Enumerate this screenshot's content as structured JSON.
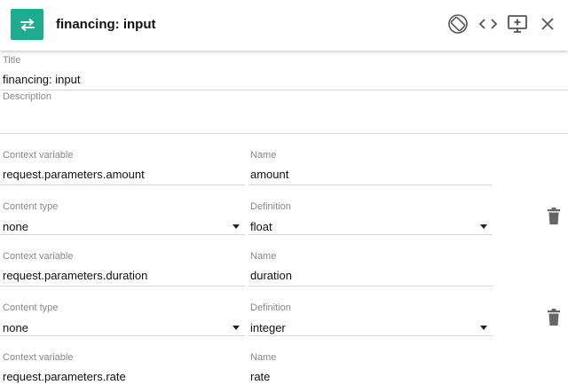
{
  "header": {
    "title": "financing: input",
    "icons": [
      "swap-arrows-icon",
      "screen-rotation-icon",
      "code-icon",
      "desktop-add-icon",
      "close-icon"
    ]
  },
  "form": {
    "title_label": "Title",
    "title_value": "financing: input",
    "description_label": "Description",
    "description_value": ""
  },
  "rows": [
    {
      "context_variable_label": "Context variable",
      "context_variable": "request.parameters.amount",
      "name_label": "Name",
      "name": "amount",
      "content_type_label": "Content type",
      "content_type": "none",
      "definition_label": "Definition",
      "definition": "float"
    },
    {
      "context_variable_label": "Context variable",
      "context_variable": "request.parameters.duration",
      "name_label": "Name",
      "name": "duration",
      "content_type_label": "Content type",
      "content_type": "none",
      "definition_label": "Definition",
      "definition": "integer"
    },
    {
      "context_variable_label": "Context variable",
      "context_variable": "request.parameters.rate",
      "name_label": "Name",
      "name": "rate"
    }
  ],
  "colors": {
    "accent": "#1eab8e",
    "label": "#888888",
    "divider": "#d6d6d6"
  }
}
